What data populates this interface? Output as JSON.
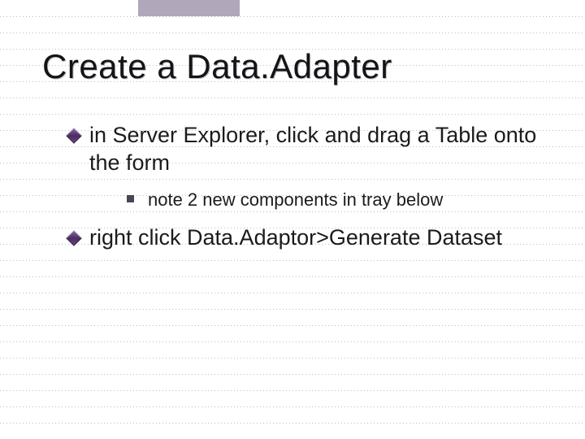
{
  "slide": {
    "title": "Create a Data.Adapter",
    "bullets": [
      {
        "text": "in Server Explorer, click and drag a Table onto the form",
        "sub": [
          {
            "text": "note 2 new components in tray below"
          }
        ]
      },
      {
        "text": "right click Data.Adaptor>Generate Dataset",
        "sub": []
      }
    ]
  },
  "style": {
    "bullet_color": "#6b4985",
    "subbullet_color": "#4c4555",
    "line_color": "#bfb9c7"
  }
}
